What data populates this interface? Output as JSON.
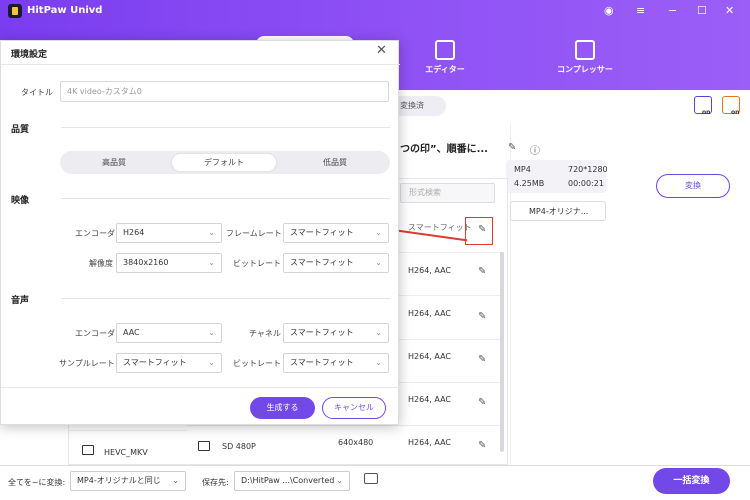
{
  "app": {
    "title": "HitPaw Univd"
  },
  "tabs": {
    "editor": "エディター",
    "compressor": "コンプレッサー"
  },
  "toolbar": {
    "chip": "変換済",
    "on1": "on",
    "on2": "on"
  },
  "file": {
    "title": "つの印”、順番に...",
    "format": "MP4",
    "resolution": "720*1280",
    "size": "4.25MB",
    "duration": "00:00:21",
    "convert": "変換",
    "output_format": "MP4-オリジナ..."
  },
  "format_panel": {
    "search_placeholder": "形式検索",
    "header": "スマートフィット",
    "rows": [
      {
        "codec": "H264, AAC"
      },
      {
        "codec": "H264, AAC"
      },
      {
        "codec": "H264, AAC"
      },
      {
        "codec": "H264, AAC"
      },
      {
        "name": "SD 480P",
        "res": "640x480",
        "codec": "H264, AAC"
      }
    ],
    "side_item": "HEVC_MKV"
  },
  "bottom": {
    "convert_all_label": "全てを~に変換:",
    "convert_all_value": "MP4-オリジナルと同じ",
    "save_label": "保存先:",
    "save_path": "D:\\HitPaw ...\\Converted",
    "batch_convert": "一括変換"
  },
  "modal": {
    "title": "環境設定",
    "title_label": "タイトル",
    "title_placeholder": "4K video-カスタム0",
    "quality_section": "品質",
    "quality_high": "高品質",
    "quality_default": "デフォルト",
    "quality_low": "低品質",
    "video_section": "映像",
    "encoder_label": "エンコーダ",
    "video_encoder": "H264",
    "framerate_label": "フレームレート",
    "framerate": "スマートフィット",
    "resolution_label": "解像度",
    "resolution": "3840x2160",
    "bitrate_label": "ビットレート",
    "video_bitrate": "スマートフィット",
    "audio_section": "音声",
    "audio_encoder_label": "エンコーダ",
    "audio_encoder": "AAC",
    "channel_label": "チャネル",
    "channel": "スマートフィット",
    "samplerate_label": "サンプルレート",
    "samplerate": "スマートフィット",
    "audio_bitrate_label": "ビットレート",
    "audio_bitrate": "スマートフィット",
    "create": "生成する",
    "cancel": "キャンセル"
  }
}
